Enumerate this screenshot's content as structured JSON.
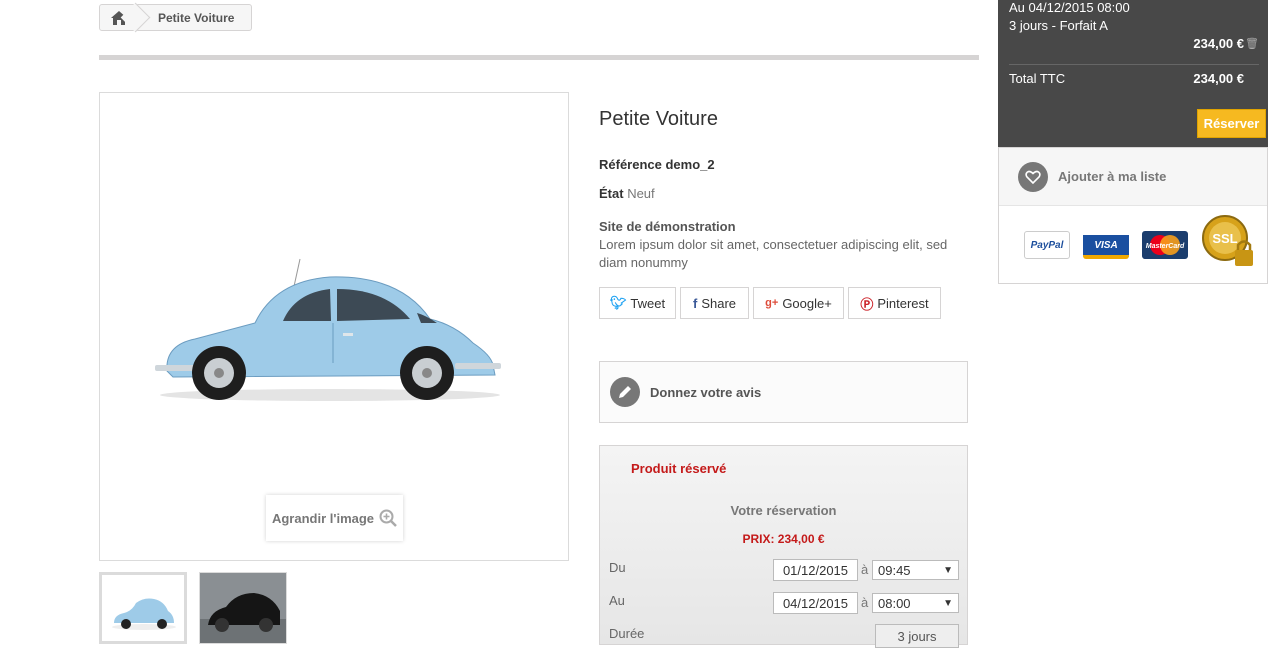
{
  "breadcrumb": {
    "current": "Petite Voiture"
  },
  "product": {
    "title": "Petite Voiture",
    "reference": "Référence demo_2",
    "condition_label": "État",
    "condition_value": "Neuf",
    "description_title": "Site de démonstration",
    "description": "Lorem ipsum dolor sit amet, consectetuer adipiscing elit, sed diam nonummy",
    "zoom_label": "Agrandir l'image"
  },
  "share": {
    "tweet": "Tweet",
    "share": "Share",
    "google": "Google+",
    "pinterest": "Pinterest"
  },
  "review": {
    "label": "Donnez votre avis"
  },
  "booking": {
    "status": "Produit réservé",
    "heading": "Votre réservation",
    "price": "PRIX: 234,00 €",
    "from_label": "Du",
    "to_label": "Au",
    "duration_label": "Durée",
    "at": "à",
    "from_date": "01/12/2015",
    "from_time": "09:45",
    "to_date": "04/12/2015",
    "to_time": "08:00",
    "duration_value": "3 jours"
  },
  "cart": {
    "line1": "Au 04/12/2015 08:00",
    "line2": "3 jours - Forfait A",
    "item_amount": "234,00 €",
    "total_label": "Total TTC",
    "total_amount": "234,00 €",
    "button": "Réserver"
  },
  "wishlist": {
    "label": "Ajouter à ma liste"
  },
  "payment": {
    "paypal": "PayPal",
    "visa": "VISA",
    "mastercard": "MasterCard",
    "ssl": "SSL"
  },
  "colors": {
    "accent_red": "#c41a1a",
    "cart_bg": "#484848",
    "reserve_button": "#f6b920",
    "car_body": "#9ecbe8"
  },
  "icons": [
    "home-icon",
    "zoom-icon",
    "twitter-icon",
    "facebook-icon",
    "google-plus-icon",
    "pinterest-icon",
    "pencil-icon",
    "trash-icon",
    "heart-icon"
  ]
}
